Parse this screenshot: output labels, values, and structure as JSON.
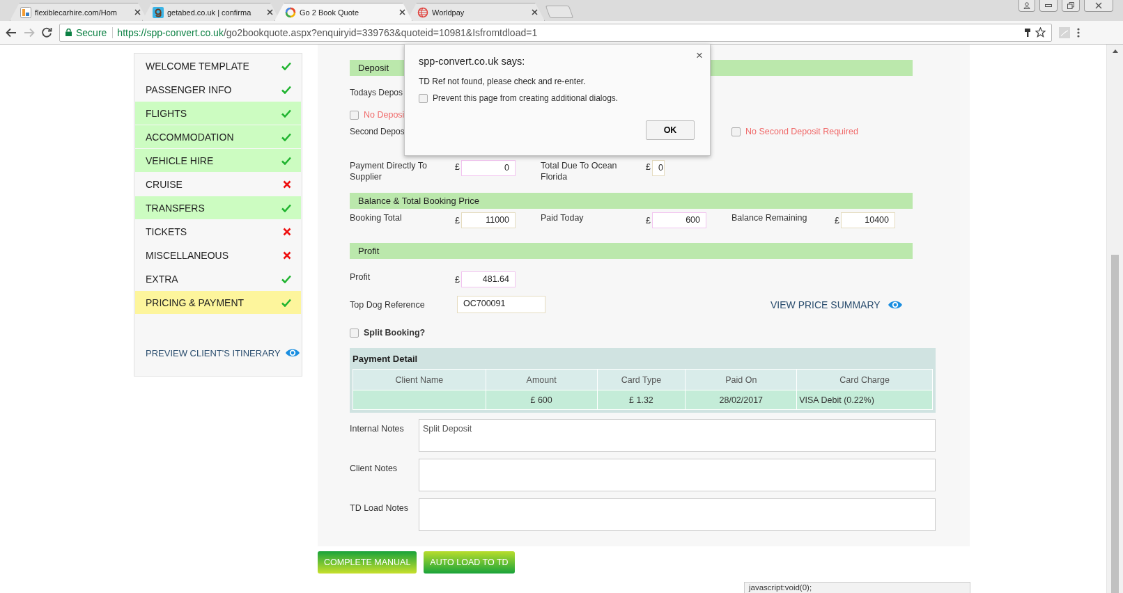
{
  "browser": {
    "tabs": [
      {
        "label": "flexiblecarhire.com/Hom",
        "selected": false
      },
      {
        "label": "getabed.co.uk | confirma",
        "selected": false
      },
      {
        "label": "Go 2 Book Quote",
        "selected": true
      },
      {
        "label": "Worldpay",
        "selected": false
      }
    ],
    "security": "Secure",
    "url_host": "https://spp-convert.co.uk",
    "url_path": "/go2bookquote.aspx?enquiryid=339763&quoteid=10981&Isfromtdload=1"
  },
  "sidebar": {
    "items": [
      {
        "label": "WELCOME TEMPLATE",
        "complete": true,
        "filled": false,
        "selected": false
      },
      {
        "label": "PASSENGER INFO",
        "complete": true,
        "filled": false,
        "selected": false
      },
      {
        "label": "FLIGHTS",
        "complete": true,
        "filled": true,
        "selected": false
      },
      {
        "label": "ACCOMMODATION",
        "complete": true,
        "filled": true,
        "selected": false
      },
      {
        "label": "VEHICLE HIRE",
        "complete": true,
        "filled": true,
        "selected": false
      },
      {
        "label": "CRUISE",
        "complete": false,
        "filled": false,
        "selected": false
      },
      {
        "label": "TRANSFERS",
        "complete": true,
        "filled": true,
        "selected": false
      },
      {
        "label": "TICKETS",
        "complete": false,
        "filled": false,
        "selected": false
      },
      {
        "label": "MISCELLANEOUS",
        "complete": false,
        "filled": false,
        "selected": false
      },
      {
        "label": "EXTRA",
        "complete": true,
        "filled": false,
        "selected": false
      },
      {
        "label": "PRICING & PAYMENT",
        "complete": true,
        "filled": false,
        "selected": true
      }
    ],
    "preview_link": "PREVIEW CLIENT'S ITINERARY"
  },
  "deposit": {
    "title": "Deposit",
    "todays_label": "Todays Depos",
    "no_deposit": {
      "label": "No Deposi",
      "checked": false
    },
    "second_label": "Second Depos",
    "no_second_deposit": {
      "label": "No Second Deposit Required",
      "checked": false
    },
    "fields": [
      {
        "label": "Payment Directly To Supplier",
        "currency": "£",
        "value": "0"
      },
      {
        "label": "Total Due To Ocean Florida",
        "currency": "£",
        "value": "0"
      }
    ]
  },
  "balance": {
    "title": "Balance & Total Booking Price",
    "fields": [
      {
        "label": "Booking Total",
        "currency": "£",
        "value": "11000"
      },
      {
        "label": "Paid Today",
        "currency": "£",
        "value": "600"
      },
      {
        "label": "Balance Remaining",
        "currency": "£",
        "value": "10400"
      }
    ]
  },
  "profit": {
    "title": "Profit",
    "label": "Profit",
    "currency": "£",
    "value": "481.64",
    "top_dog_label": "Top Dog Reference",
    "top_dog_value": "OC700091",
    "price_summary_link": "VIEW PRICE SUMMARY",
    "split_booking": {
      "label": "Split Booking?",
      "checked": false
    }
  },
  "payment_detail": {
    "title": "Payment Detail",
    "columns": [
      "Client Name",
      "Amount",
      "Card Type",
      "Paid On",
      "Card Charge"
    ],
    "rows": [
      [
        "",
        "£ 600",
        "£ 1.32",
        "28/02/2017",
        "VISA Debit (0.22%)"
      ]
    ]
  },
  "notes": [
    {
      "label": "Internal Notes",
      "value": "Split Deposit"
    },
    {
      "label": "Client Notes"
    },
    {
      "label": "TD Load Notes"
    }
  ],
  "buttons": [
    "COMPLETE MANUAL",
    "AUTO LOAD TO TD"
  ],
  "dialog": {
    "title": "spp-convert.co.uk says:",
    "message": "TD Ref not found, please check and re-enter.",
    "close": "×",
    "prevent": {
      "label": "Prevent this page from creating additional dialogs.",
      "checked": false
    },
    "ok": "OK"
  },
  "status_bar": "javascript:void(0);"
}
